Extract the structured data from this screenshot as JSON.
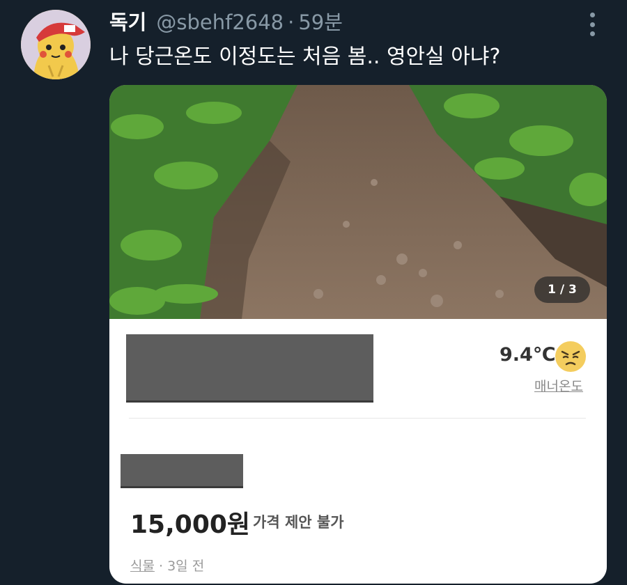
{
  "tweet": {
    "display_name": "독기",
    "handle": "@sbehf2648",
    "separator": "·",
    "time": "59분",
    "text": "나 당근온도 이정도는 처음 봄.. 영안실 아냐?"
  },
  "icons": {
    "avatar": "pikachu-avatar",
    "more": "vertical-dots-icon",
    "temperature_face": "angry-face-icon"
  },
  "card": {
    "image_counter": "1 / 3",
    "manner_temp": "9.4℃",
    "manner_label": "매너온도",
    "price": "15,000원",
    "price_note": "가격 제안 불가",
    "category": "식물",
    "meta_separator": " · ",
    "posted": "3일 전"
  },
  "colors": {
    "background": "#15202b",
    "secondary_text": "#8899a6",
    "card_background": "#ffffff",
    "redaction": "#5d5d5d"
  }
}
